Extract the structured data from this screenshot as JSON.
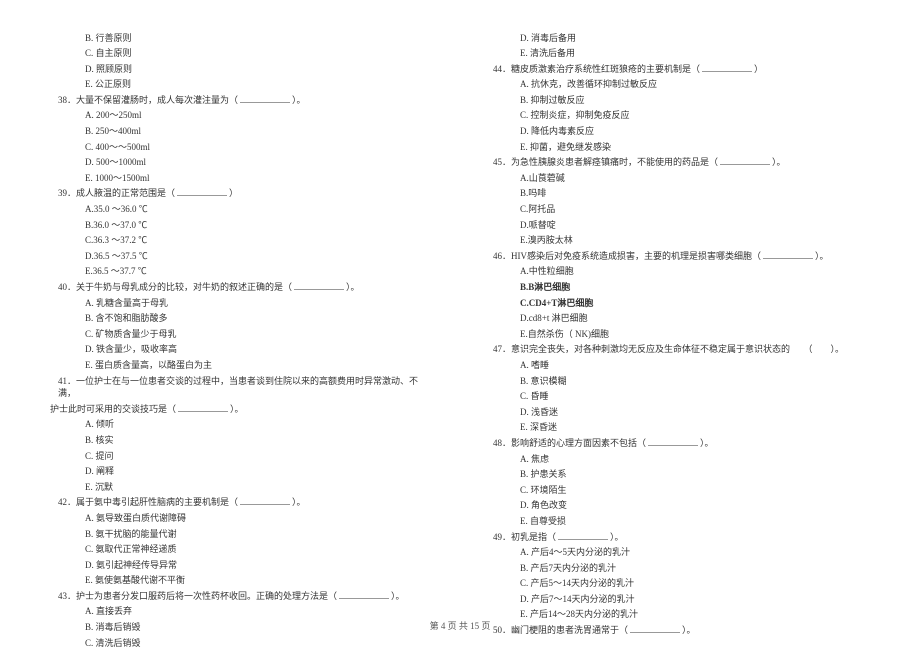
{
  "left": {
    "opts37": [
      {
        "label": "B",
        "text": "行善原则"
      },
      {
        "label": "C",
        "text": "自主原则"
      },
      {
        "label": "D",
        "text": "照顾原则"
      },
      {
        "label": "E",
        "text": "公正原则"
      }
    ],
    "q38": {
      "num": "38．",
      "text": "大量不保留灌肠时，成人每次灌注量为（",
      "tail": "）。"
    },
    "opts38": [
      {
        "label": "A",
        "text": "200～250ml"
      },
      {
        "label": "B",
        "text": "250～400ml"
      },
      {
        "label": "C",
        "text": "400～～500ml"
      },
      {
        "label": "D",
        "text": "500～1000ml"
      },
      {
        "label": "E",
        "text": "1000～1500ml"
      }
    ],
    "q39": {
      "num": "39．",
      "text": "成人腋温的正常范围是（",
      "tail": "）"
    },
    "opts39": [
      {
        "label": "A",
        "text": "35.0 ～36.0 ℃"
      },
      {
        "label": "B",
        "text": "36.0 ～37.0 ℃"
      },
      {
        "label": "C",
        "text": "36.3 ～37.2 ℃"
      },
      {
        "label": "D",
        "text": "36.5 ～37.5 ℃"
      },
      {
        "label": "E",
        "text": "36.5 ～37.7 ℃"
      }
    ],
    "q40": {
      "num": "40．",
      "text": "关于牛奶与母乳成分的比较，对牛奶的叙述正确的是（",
      "tail": "）。"
    },
    "opts40": [
      {
        "label": "A",
        "text": "乳糖含量高于母乳"
      },
      {
        "label": "B",
        "text": "含不饱和脂肪酸多"
      },
      {
        "label": "C",
        "text": "矿物质含量少于母乳"
      },
      {
        "label": "D",
        "text": "铁含量少，吸收率高"
      },
      {
        "label": "E",
        "text": "蛋白质含量高，以酪蛋白为主"
      }
    ],
    "q41": {
      "num": "41．",
      "text": "一位护士在与一位患者交谈的过程中，当患者谈到住院以来的高额费用时异常激动、不满，",
      "cont": "护士此时可采用的交谈技巧是（",
      "tail": "）。"
    },
    "opts41": [
      {
        "label": "A",
        "text": "倾听"
      },
      {
        "label": "B",
        "text": "核实"
      },
      {
        "label": "C",
        "text": "提问"
      },
      {
        "label": "D",
        "text": "阐释"
      },
      {
        "label": "E",
        "text": "沉默"
      }
    ],
    "q42": {
      "num": "42．",
      "text": "属于氨中毒引起肝性脑病的主要机制是（",
      "tail": "）。"
    },
    "opts42": [
      {
        "label": "A",
        "text": "氨导致蛋白质代谢障碍"
      },
      {
        "label": "B",
        "text": "氨干扰脑的能量代谢"
      },
      {
        "label": "C",
        "text": "氨取代正常神经递质"
      },
      {
        "label": "D",
        "text": "氨引起神经传导异常"
      },
      {
        "label": "E",
        "text": "氨使氨基酸代谢不平衡"
      }
    ],
    "q43": {
      "num": "43．",
      "text": "护士为患者分发口服药后将一次性药杯收回。正确的处理方法是（",
      "tail": "）。"
    },
    "opts43": [
      {
        "label": "A",
        "text": "直接丢弃"
      },
      {
        "label": "B",
        "text": "消毒后销毁"
      },
      {
        "label": "C",
        "text": "清洗后销毁"
      }
    ]
  },
  "right": {
    "opts43b": [
      {
        "label": "D",
        "text": "消毒后备用"
      },
      {
        "label": "E",
        "text": "清洗后备用"
      }
    ],
    "q44": {
      "num": "44．",
      "text": "糖皮质激素治疗系统性红斑狼疮的主要机制是（",
      "tail": "）"
    },
    "opts44": [
      {
        "label": "A",
        "text": "抗休克，改善循环抑制过敏反应"
      },
      {
        "label": "B",
        "text": "抑制过敏反应"
      },
      {
        "label": "C",
        "text": "控制炎症，抑制免疫反应"
      },
      {
        "label": "D",
        "text": "降低内毒素反应"
      },
      {
        "label": "E",
        "text": "抑菌，避免继发感染"
      }
    ],
    "q45": {
      "num": "45．",
      "text": "为急性胰腺炎患者解痉镇痛时，不能使用的药品是（",
      "tail": "）。"
    },
    "opts45": [
      {
        "label": "A",
        "text": "山莨菪碱"
      },
      {
        "label": "B",
        "text": "吗啡"
      },
      {
        "label": "C",
        "text": "阿托品"
      },
      {
        "label": "D",
        "text": "哌替啶"
      },
      {
        "label": "E",
        "text": "溴丙胺太林"
      }
    ],
    "q46": {
      "num": "46．",
      "text": "HIV感染后对免疫系统造成损害，主要的机理是损害哪类细胞（",
      "tail": "）。"
    },
    "opts46": [
      {
        "label": "A",
        "text": "中性粒细胞"
      },
      {
        "label": "B",
        "text": "B淋巴细胞",
        "bold": true
      },
      {
        "label": "C",
        "text": "CD4+T淋巴细胞",
        "bold": true
      },
      {
        "label": "D",
        "text": "cd8+t 淋巴细胞"
      },
      {
        "label": "E",
        "text": "自然杀伤（ NK)细胞"
      }
    ],
    "q47": {
      "num": "47．",
      "text": "意识完全丧失，对各种刺激均无反应及生命体征不稳定属于意识状态的",
      "tail": "（　　）。"
    },
    "opts47": [
      {
        "label": "A",
        "text": "嗜睡"
      },
      {
        "label": "B",
        "text": "意识模糊"
      },
      {
        "label": "C",
        "text": "昏睡"
      },
      {
        "label": "D",
        "text": "浅昏迷"
      },
      {
        "label": "E",
        "text": "深昏迷"
      }
    ],
    "q48": {
      "num": "48．",
      "text": "影响舒适的心理方面因素不包括（",
      "tail": "）。"
    },
    "opts48": [
      {
        "label": "A",
        "text": "焦虑"
      },
      {
        "label": "B",
        "text": "护患关系"
      },
      {
        "label": "C",
        "text": "环境陌生"
      },
      {
        "label": "D",
        "text": "角色改变"
      },
      {
        "label": "E",
        "text": "自尊受损"
      }
    ],
    "q49": {
      "num": "49．",
      "text": "初乳是指（",
      "tail": "）。"
    },
    "opts49": [
      {
        "label": "A",
        "text": "产后4～5天内分泌的乳汁"
      },
      {
        "label": "B",
        "text": "产后7天内分泌的乳汁"
      },
      {
        "label": "C",
        "text": "产后5～14天内分泌的乳汁"
      },
      {
        "label": "D",
        "text": "产后7～14天内分泌的乳汁"
      },
      {
        "label": "E",
        "text": "产后14～28天内分泌的乳汁"
      }
    ],
    "q50": {
      "num": "50．",
      "text": "幽门梗阻的患者洗胃通常于（",
      "tail": "）。"
    }
  },
  "footer": {
    "prefix": "第 ",
    "page": "4",
    "middle": " 页 共 ",
    "total": "15",
    "suffix": " 页"
  }
}
